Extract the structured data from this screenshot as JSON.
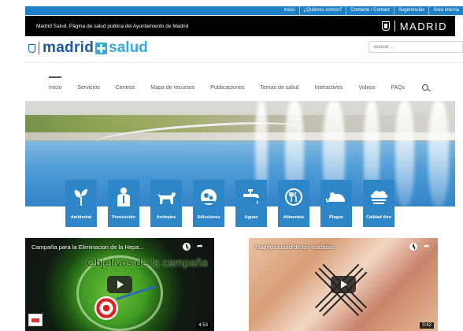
{
  "top_links": [
    "Inicio",
    "¿Quiénes somos?",
    "Contacte / Contact",
    "Sugerencias",
    "Área interna"
  ],
  "black_band": {
    "text": "Madrid Salud. Página de salud pública del Ayuntamiento de Madrid",
    "logo_text": "MADRID"
  },
  "brand": {
    "part1": "madrid",
    "part2": "salud"
  },
  "search": {
    "placeholder": "Buscar ..."
  },
  "nav": [
    "Inicio",
    "Servicios",
    "Centros",
    "Mapa de recursos",
    "Publicaciones",
    "Temas de salud",
    "Interactivos",
    "Videos",
    "FAQs"
  ],
  "categories": [
    {
      "label": "Ambiental",
      "icon": "plant-icon"
    },
    {
      "label": "Prevención",
      "icon": "doctor-icon"
    },
    {
      "label": "Animales",
      "icon": "dog-icon"
    },
    {
      "label": "Adicciones",
      "icon": "pills-icon"
    },
    {
      "label": "Aguas",
      "icon": "faucet-icon"
    },
    {
      "label": "Alimentos",
      "icon": "plate-cutlery-icon"
    },
    {
      "label": "Plagas",
      "icon": "mouse-icon"
    },
    {
      "label": "Calidad Aire",
      "icon": "cloud-icon"
    }
  ],
  "videos": [
    {
      "title": "Campaña para la Eliminacion de la Hepa...",
      "overlay": "Objetivos de la campaña",
      "duration": "4:53"
    },
    {
      "title": "Madrid ciudad de los cuidados",
      "duration": "0:42"
    }
  ],
  "colors": {
    "accent_blue": "#1f80c5",
    "brand_dark": "#1a5aa0",
    "brand_light": "#39a9dc",
    "tile_blue": "#2e86c9"
  }
}
